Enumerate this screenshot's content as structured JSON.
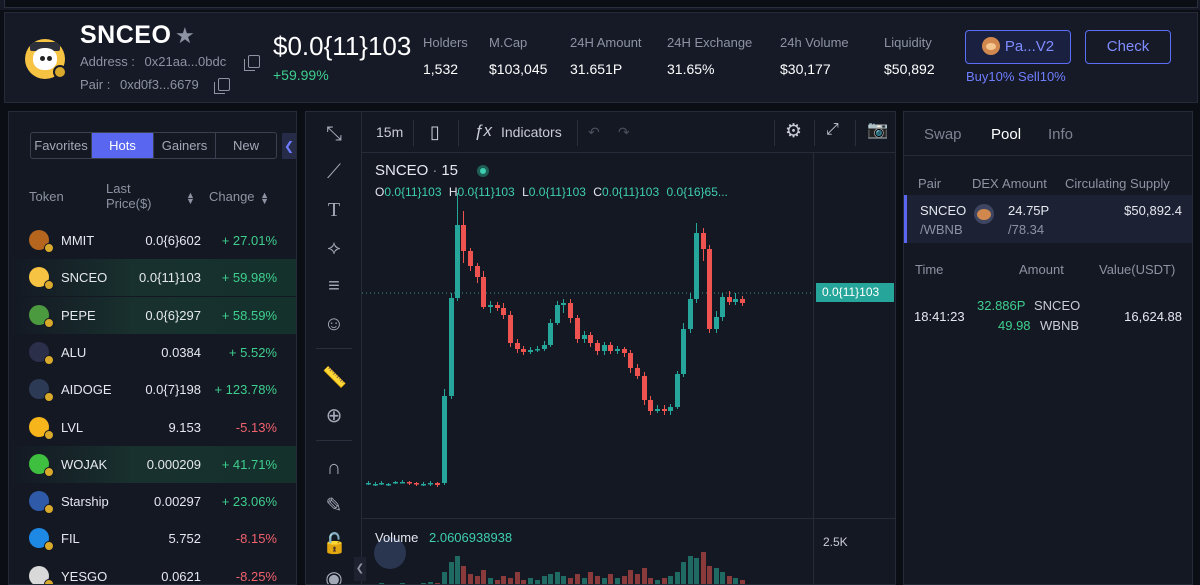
{
  "header": {
    "token_name": "SNCEO",
    "address_label": "Address :",
    "address_value": "0x21aa...0bdc",
    "pair_label": "Pair :",
    "pair_value": "0xd0f3...6679",
    "price": "$0.0{11}103",
    "price_change": "+59.99%",
    "stats": [
      {
        "label": "Holders",
        "value": "1,532"
      },
      {
        "label": "M.Cap",
        "value": "$103,045"
      },
      {
        "label": "24H Amount",
        "value": "31.651P"
      },
      {
        "label": "24H Exchange",
        "value": "31.65%"
      },
      {
        "label": "24h Volume",
        "value": "$30,177"
      },
      {
        "label": "Liquidity",
        "value": "$50,892"
      }
    ],
    "pair_button": "Pa...V2",
    "check_button": "Check",
    "tax_info": "Buy10% Sell10%"
  },
  "left": {
    "tabs": [
      "Favorites",
      "Hots",
      "Gainers",
      "New"
    ],
    "active_tab": "Hots",
    "columns": {
      "token": "Token",
      "price": "Last Price($)",
      "change": "Change"
    },
    "rows": [
      {
        "name": "MMIT",
        "price": "0.0{6}602",
        "change": "+ 27.01%",
        "dir": "up"
      },
      {
        "name": "SNCEO",
        "price": "0.0{11}103",
        "change": "+ 59.98%",
        "dir": "up"
      },
      {
        "name": "PEPE",
        "price": "0.0{6}297",
        "change": "+ 58.59%",
        "dir": "up"
      },
      {
        "name": "ALU",
        "price": "0.0384",
        "change": "+ 5.52%",
        "dir": "up"
      },
      {
        "name": "AIDOGE",
        "price": "0.0{7}198",
        "change": "+ 123.78%",
        "dir": "up"
      },
      {
        "name": "LVL",
        "price": "9.153",
        "change": "-5.13%",
        "dir": "down"
      },
      {
        "name": "WOJAK",
        "price": "0.000209",
        "change": "+ 41.71%",
        "dir": "up"
      },
      {
        "name": "Starship",
        "price": "0.00297",
        "change": "+ 23.06%",
        "dir": "up"
      },
      {
        "name": "FIL",
        "price": "5.752",
        "change": "-8.15%",
        "dir": "down"
      },
      {
        "name": "YESGO",
        "price": "0.0621",
        "change": "-8.25%",
        "dir": "down"
      }
    ]
  },
  "chart": {
    "interval": "15m",
    "indicators_label": "Indicators",
    "symbol": "SNCEO",
    "symbol_interval": "15",
    "ohlc": {
      "o": "0.0{11}103",
      "h": "0.0{11}103",
      "l": "0.0{11}103",
      "c": "0.0{11}103",
      "chg": "0.0{16}65..."
    },
    "last_price_tag": "0.0{11}103",
    "volume_label": "Volume",
    "volume_value": "2.0606938938",
    "volume_axis": "2.5K",
    "colors": {
      "up": "#26a69a",
      "down": "#ef5350"
    }
  },
  "right": {
    "tabs": [
      "Swap",
      "Pool",
      "Info"
    ],
    "active_tab": "Pool",
    "pool_headers": {
      "pair": "Pair",
      "dex": "DEX",
      "amount": "Amount",
      "supply": "Circulating Supply"
    },
    "pool_row": {
      "pair_top": "SNCEO",
      "pair_bottom": "/WBNB",
      "amount_top": "24.75P",
      "amount_bottom": "/78.34",
      "supply": "$50,892.4"
    },
    "tx_headers": {
      "time": "Time",
      "amount": "Amount",
      "value": "Value(USDT)"
    },
    "tx": {
      "time": "18:41:23",
      "amt1": "32.886P",
      "tok1": "SNCEO",
      "amt2": "49.98",
      "tok2": "WBNB",
      "value": "16,624.88"
    }
  }
}
